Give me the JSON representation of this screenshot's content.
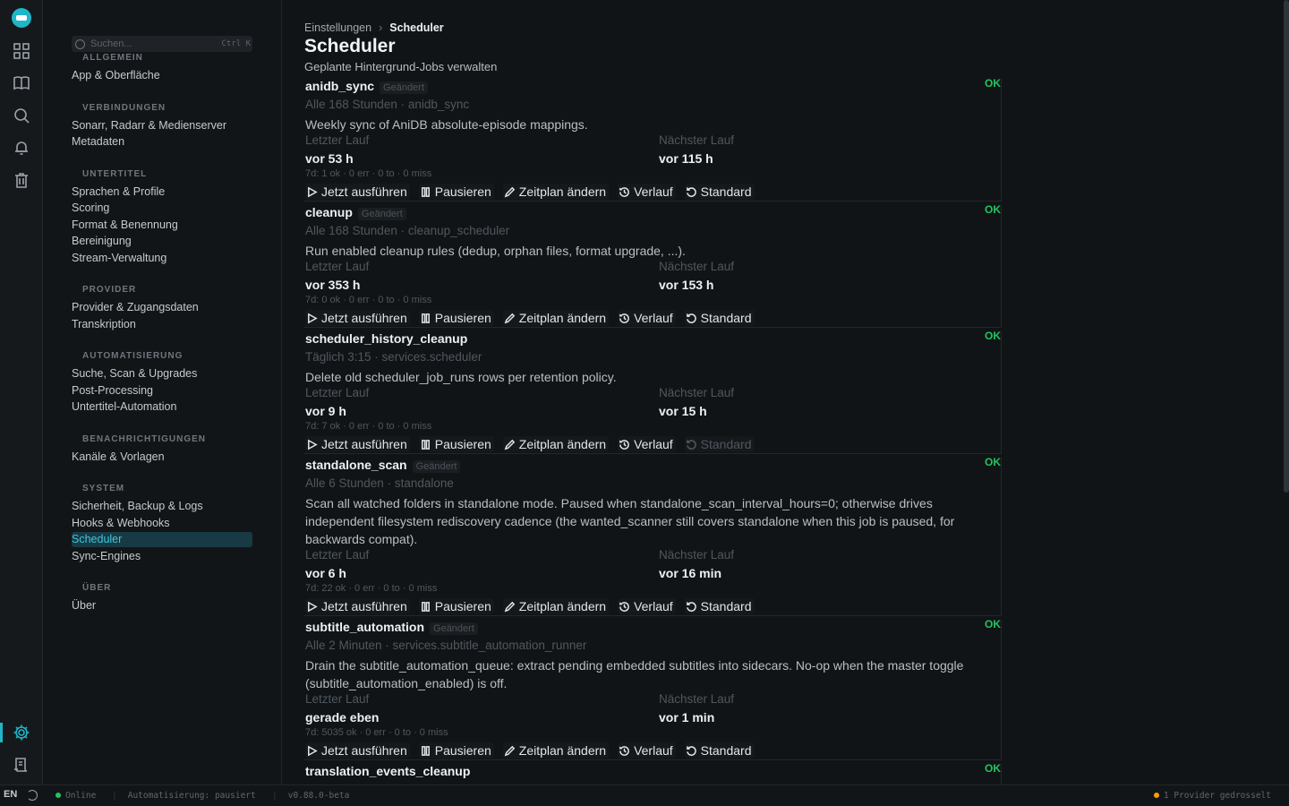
{
  "sidebar": {
    "search_placeholder": "Suchen...",
    "search_shortcut": "Ctrl K",
    "groups": [
      {
        "title": "ALLGEMEIN",
        "items": [
          "App & Oberfläche"
        ]
      },
      {
        "title": "VERBINDUNGEN",
        "items": [
          "Sonarr, Radarr & Medienserver",
          "Metadaten"
        ]
      },
      {
        "title": "UNTERTITEL",
        "items": [
          "Sprachen & Profile",
          "Scoring",
          "Format & Benennung",
          "Bereinigung",
          "Stream-Verwaltung"
        ]
      },
      {
        "title": "PROVIDER",
        "items": [
          "Provider & Zugangsdaten",
          "Transkription"
        ]
      },
      {
        "title": "AUTOMATISIERUNG",
        "items": [
          "Suche, Scan & Upgrades",
          "Post-Processing",
          "Untertitel-Automation"
        ]
      },
      {
        "title": "BENACHRICHTIGUNGEN",
        "items": [
          "Kanäle & Vorlagen"
        ]
      },
      {
        "title": "SYSTEM",
        "items": [
          "Sicherheit, Backup & Logs",
          "Hooks & Webhooks",
          "Scheduler",
          "Sync-Engines"
        ]
      },
      {
        "title": "ÜBER",
        "items": [
          "Über"
        ]
      }
    ],
    "active_item": "Scheduler"
  },
  "header": {
    "breadcrumb_parent": "Einstellungen",
    "breadcrumb_current": "Scheduler",
    "title": "Scheduler",
    "subtitle": "Geplante Hintergrund-Jobs verwalten"
  },
  "labels": {
    "last_run": "Letzter Lauf",
    "next_run": "Nächster Lauf",
    "changed_badge": "Geändert",
    "run_now": "Jetzt ausführen",
    "pause": "Pausieren",
    "change_schedule": "Zeitplan ändern",
    "history": "Verlauf",
    "default": "Standard"
  },
  "jobs": [
    {
      "name": "anidb_sync",
      "changed": true,
      "status": "OK",
      "schedule": "Alle 168 Stunden · anidb_sync",
      "description": "Weekly sync of AniDB absolute-episode mappings.",
      "last_run": "vor 53 h",
      "next_run": "vor 115 h",
      "stats": "7d: 1 ok · 0 err · 0 to · 0 miss",
      "default_enabled": true
    },
    {
      "name": "cleanup",
      "changed": true,
      "status": "OK",
      "schedule": "Alle 168 Stunden · cleanup_scheduler",
      "description": "Run enabled cleanup rules (dedup, orphan files, format upgrade, ...).",
      "last_run": "vor 353 h",
      "next_run": "vor 153 h",
      "stats": "7d: 0 ok · 0 err · 0 to · 0 miss",
      "default_enabled": true
    },
    {
      "name": "scheduler_history_cleanup",
      "changed": false,
      "status": "OK",
      "schedule": "Täglich 3:15 · services.scheduler",
      "description": "Delete old scheduler_job_runs rows per retention policy.",
      "last_run": "vor 9 h",
      "next_run": "vor 15 h",
      "stats": "7d: 7 ok · 0 err · 0 to · 0 miss",
      "default_enabled": false
    },
    {
      "name": "standalone_scan",
      "changed": true,
      "status": "OK",
      "schedule": "Alle 6 Stunden · standalone",
      "description": "Scan all watched folders in standalone mode. Paused when standalone_scan_interval_hours=0; otherwise drives independent filesystem rediscovery cadence (the wanted_scanner still covers standalone when this job is paused, for backwards compat).",
      "last_run": "vor 6 h",
      "next_run": "vor 16 min",
      "stats": "7d: 22 ok · 0 err · 0 to · 0 miss",
      "default_enabled": true
    },
    {
      "name": "subtitle_automation",
      "changed": true,
      "status": "OK",
      "schedule": "Alle 2 Minuten · services.subtitle_automation_runner",
      "description": "Drain the subtitle_automation_queue: extract pending embedded subtitles into sidecars. No-op when the master toggle (subtitle_automation_enabled) is off.",
      "last_run": "gerade eben",
      "next_run": "vor 1 min",
      "stats": "7d: 5035 ok · 0 err · 0 to · 0 miss",
      "default_enabled": true
    },
    {
      "name": "translation_events_cleanup",
      "changed": false,
      "status": "OK"
    }
  ],
  "statusbar": {
    "lang": "EN",
    "online": "Online",
    "automation": "Automatisierung: pausiert",
    "version": "v0.88.0-beta",
    "providers": "1 Provider gedrosselt",
    "online_color": "#22c55e",
    "warn_color": "#f59e0b"
  }
}
